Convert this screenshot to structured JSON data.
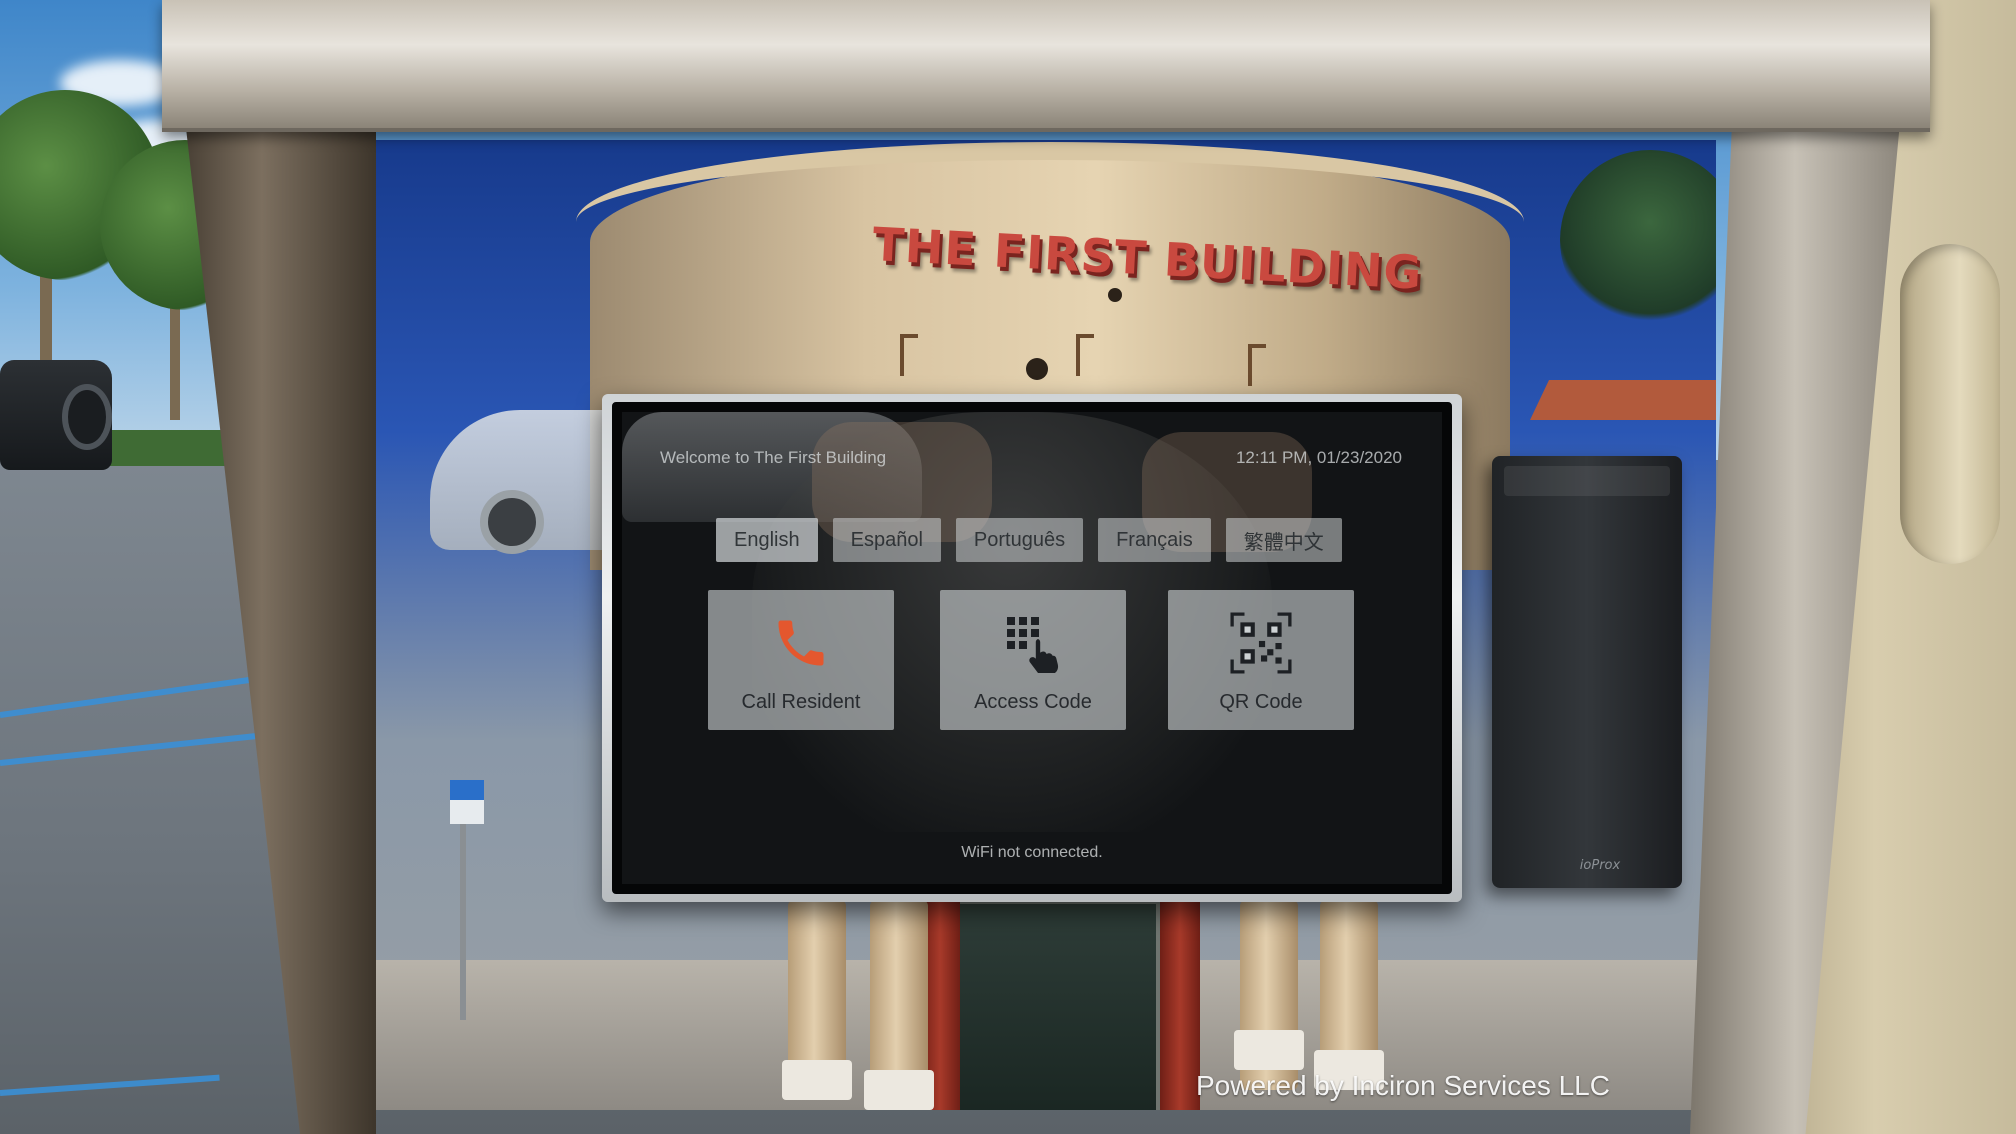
{
  "building_sign": "THE FIRST BUILDING",
  "kiosk": {
    "welcome": "Welcome to The First Building",
    "datetime": "12:11 PM, 01/23/2020",
    "languages": [
      "English",
      "Español",
      "Português",
      "Français",
      "繁體中文"
    ],
    "selected_language": "English",
    "actions": [
      {
        "label": "Call Resident",
        "icon": "phone-icon"
      },
      {
        "label": "Access Code",
        "icon": "keypad-touch-icon"
      },
      {
        "label": "QR Code",
        "icon": "qr-code-icon"
      }
    ],
    "status": "WiFi not connected."
  },
  "card_reader_logo": "ioProx",
  "footer": {
    "powered_by": "Powered by Inciron Services LLC"
  },
  "colors": {
    "phone_icon": "#e4572e",
    "sign_red": "#c9493f",
    "button_bg": "#cdd2d4"
  }
}
